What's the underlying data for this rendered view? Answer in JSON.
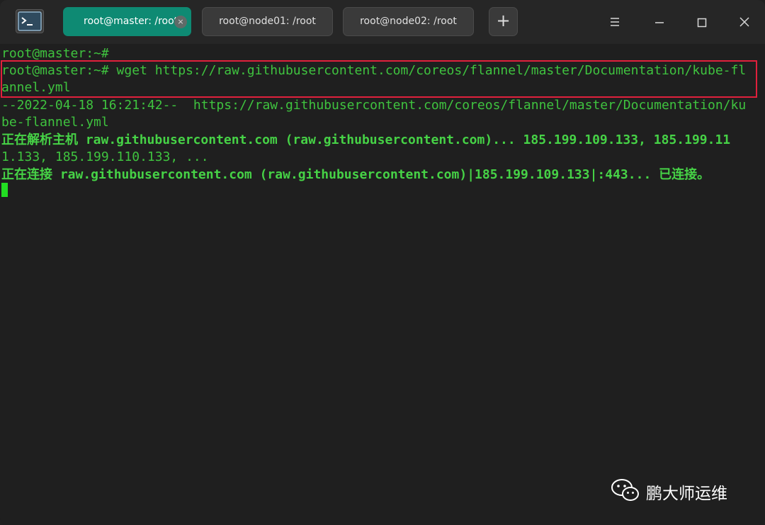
{
  "tabs": [
    {
      "label": "root@master: /root",
      "active": true
    },
    {
      "label": "root@node01: /root",
      "active": false
    },
    {
      "label": "root@node02: /root",
      "active": false
    }
  ],
  "tab_close_glyph": "×",
  "add_tab_glyph": "+",
  "window_controls": [
    "menu-icon",
    "minimize-icon",
    "maximize-icon",
    "close-icon"
  ],
  "terminal": {
    "lines": [
      "root@master:~#",
      "root@master:~# wget https://raw.githubusercontent.com/coreos/flannel/master/Documentation/kube-fl",
      "annel.yml",
      "--2022-04-18 16:21:42--  https://raw.githubusercontent.com/coreos/flannel/master/Documentation/ku",
      "be-flannel.yml",
      "正在解析主机 raw.githubusercontent.com (raw.githubusercontent.com)... 185.199.109.133, 185.199.11",
      "1.133, 185.199.110.133, ...",
      "正在连接 raw.githubusercontent.com (raw.githubusercontent.com)|185.199.109.133|:443... 已连接。"
    ]
  },
  "watermark": {
    "text": "鹏大师运维",
    "icon": "wechat-icon"
  },
  "colors": {
    "accent": "#0e8a73",
    "terminal_text": "#3fc33f",
    "terminal_bg": "#1f1f1f",
    "highlight": "#e0203c"
  }
}
